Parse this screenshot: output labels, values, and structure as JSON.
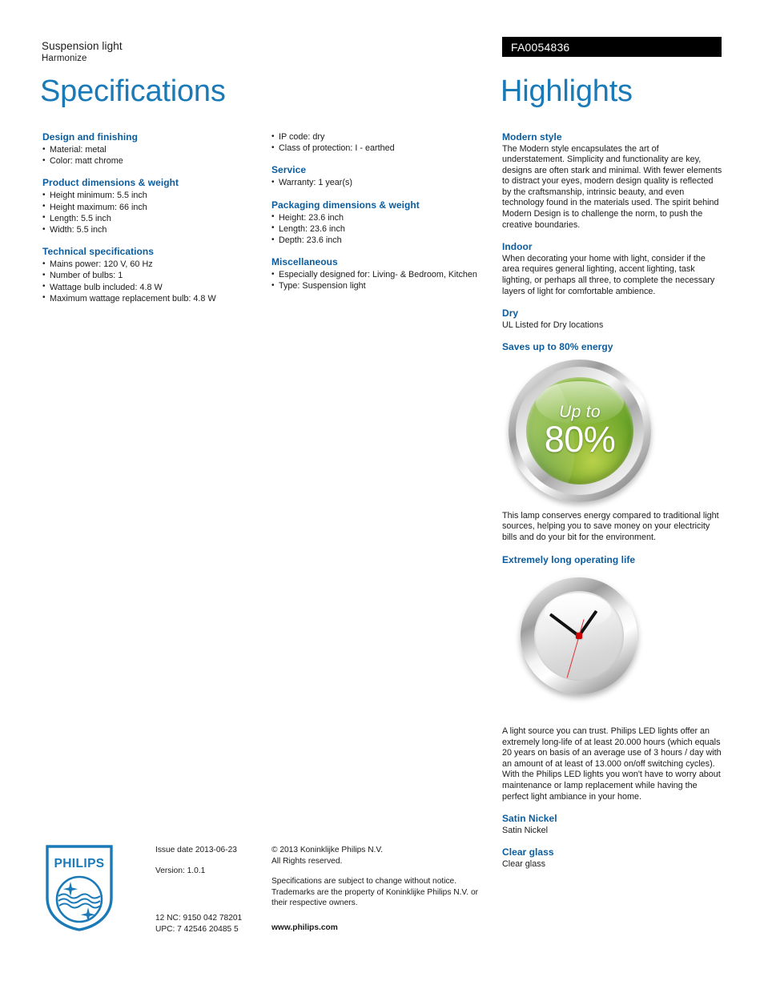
{
  "header": {
    "product_type": "Suspension light",
    "product_family": "Harmonize",
    "product_code": "FA0054836",
    "specifications_title": "Specifications",
    "highlights_title": "Highlights"
  },
  "colors": {
    "title_blue": "#1a7ab8",
    "heading_blue": "#0b5c9e",
    "banner_black": "#000000",
    "badge_green": "#7fb335"
  },
  "specifications": {
    "column_1": [
      {
        "title": "Design and finishing",
        "items": [
          "Material: metal",
          "Color: matt chrome"
        ]
      },
      {
        "title": "Product dimensions & weight",
        "items": [
          "Height minimum: 5.5 inch",
          "Height maximum: 66 inch",
          "Length: 5.5 inch",
          "Width: 5.5 inch"
        ]
      },
      {
        "title": "Technical specifications",
        "items": [
          "Mains power: 120 V, 60 Hz",
          "Number of bulbs: 1",
          "Wattage bulb included: 4.8 W",
          "Maximum wattage replacement bulb: 4.8 W"
        ]
      }
    ],
    "column_2": [
      {
        "title": "",
        "items": [
          "IP code: dry",
          "Class of protection: I - earthed"
        ]
      },
      {
        "title": "Service",
        "items": [
          "Warranty: 1 year(s)"
        ]
      },
      {
        "title": "Packaging dimensions & weight",
        "items": [
          "Height: 23.6 inch",
          "Length: 23.6 inch",
          "Depth: 23.6 inch"
        ]
      },
      {
        "title": "Miscellaneous",
        "items": [
          "Especially designed for: Living- & Bedroom, Kitchen",
          "Type: Suspension light"
        ]
      }
    ]
  },
  "highlights": [
    {
      "title": "Modern style",
      "body": "The Modern style encapsulates the art of understatement. Simplicity and functionality are key, designs are often stark and minimal. With fewer elements to distract your eyes, modern design quality is reflected by the craftsmanship, intrinsic beauty, and even technology found in the materials used. The spirit behind Modern Design is to challenge the norm, to push the creative boundaries."
    },
    {
      "title": "Indoor",
      "body": "When decorating your home with light, consider if the area requires general lighting, accent lighting, task lighting, or perhaps all three, to complete the necessary layers of light for comfortable ambience."
    },
    {
      "title": "Dry",
      "body": "UL Listed for Dry locations"
    },
    {
      "title": "Saves up to 80% energy",
      "body": "This lamp conserves energy compared to traditional light sources, helping you to save money on your electricity bills and do your bit for the environment."
    },
    {
      "title": "Extremely long operating life",
      "body": "A light source you can trust. Philips LED lights offer an extremely long-life of at least 20.000 hours (which equals 20 years on basis of an average use of 3 hours / day with an amount of at least of 13.000 on/off switching cycles). With the Philips LED lights you won't have to worry about maintenance or lamp replacement while having the perfect light ambiance in your home."
    },
    {
      "title": "Satin Nickel",
      "body": "Satin Nickel"
    },
    {
      "title": "Clear glass",
      "body": "Clear glass"
    }
  ],
  "energy_badge": {
    "upto_label": "Up to",
    "percent_label": "80%"
  },
  "footer": {
    "logo_wordmark": "PHILIPS",
    "issue_date": "Issue date 2013-06-23",
    "version": "Version: 1.0.1",
    "twelve_nc": "12 NC: 9150 042 78201",
    "upc": "UPC: 7 42546 20485 5",
    "copyright_line_1": "© 2013 Koninklijke Philips N.V.",
    "copyright_line_2": "All Rights reserved.",
    "disclaimer": "Specifications are subject to change without notice. Trademarks are the property of Koninklijke Philips N.V. or their respective owners.",
    "website": "www.philips.com"
  }
}
